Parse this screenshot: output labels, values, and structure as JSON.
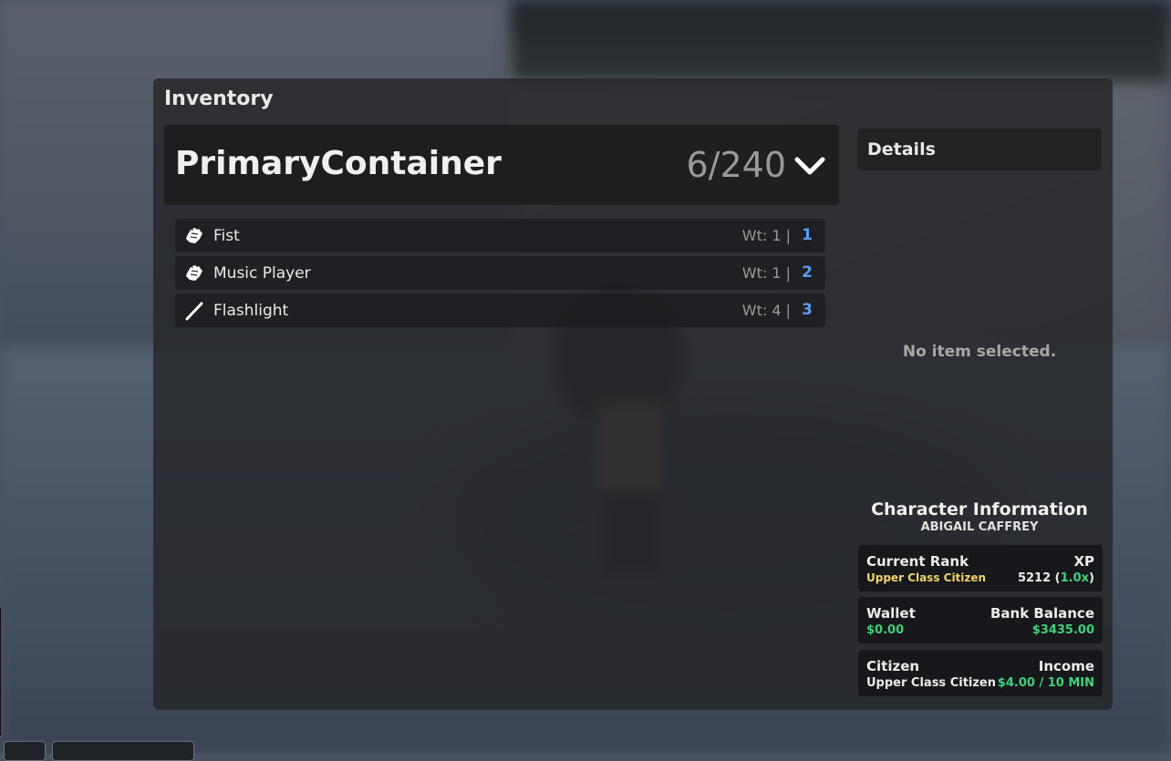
{
  "inventory": {
    "title": "Inventory",
    "container": {
      "name": "PrimaryContainer",
      "count": "6/240"
    },
    "items": [
      {
        "name": "Fist",
        "weight": "Wt: 1 |",
        "slot": "1",
        "icon": "glove-icon"
      },
      {
        "name": "Music Player",
        "weight": "Wt: 1 |",
        "slot": "2",
        "icon": "glove-icon"
      },
      {
        "name": "Flashlight",
        "weight": "Wt: 4 |",
        "slot": "3",
        "icon": "stick-icon"
      }
    ]
  },
  "details": {
    "title": "Details",
    "empty_text": "No item selected."
  },
  "character": {
    "title": "Character Information",
    "name": "ABIGAIL CAFFREY",
    "rank_label": "Current Rank",
    "rank_value": "Upper Class Citizen",
    "xp_label": "XP",
    "xp_value": "5212",
    "xp_paren_open": "(",
    "xp_multiplier": "1.0x",
    "xp_paren_close": ")",
    "wallet_label": "Wallet",
    "wallet_value": "$0.00",
    "bank_label": "Bank Balance",
    "bank_value": "$3435.00",
    "citizen_label": "Citizen",
    "citizen_value": "Upper Class Citizen",
    "income_label": "Income",
    "income_value": "$4.00 / 10 MIN"
  },
  "colors": {
    "slot_number": "#5b9df0",
    "rank_yellow": "#f0d36a",
    "money_green": "#3fd17a"
  }
}
